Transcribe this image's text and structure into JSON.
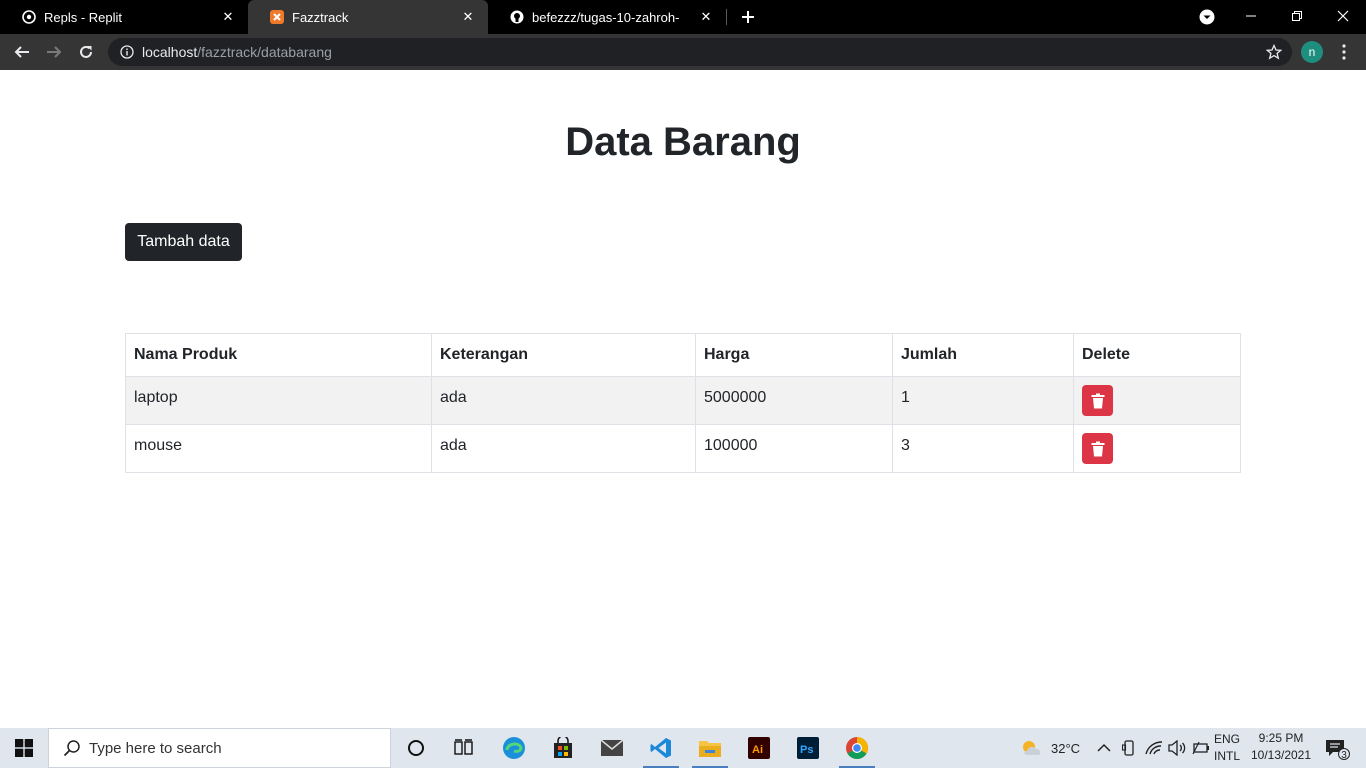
{
  "browser": {
    "tabs": [
      {
        "title": "Repls - Replit",
        "icon": "replit-icon",
        "active": false
      },
      {
        "title": "Fazztrack",
        "icon": "xampp-icon",
        "active": true
      },
      {
        "title": "befezzz/tugas-10-zahroh-",
        "icon": "github-icon",
        "active": false
      }
    ],
    "address": {
      "host": "localhost",
      "path": "/fazztrack/databarang"
    },
    "profile_initial": "n"
  },
  "page": {
    "title": "Data Barang",
    "add_button_label": "Tambah data",
    "table": {
      "headers": [
        "Nama Produk",
        "Keterangan",
        "Harga",
        "Jumlah",
        "Delete"
      ],
      "rows": [
        {
          "nama": "laptop",
          "keterangan": "ada",
          "harga": "5000000",
          "jumlah": "1"
        },
        {
          "nama": "mouse",
          "keterangan": "ada",
          "harga": "100000",
          "jumlah": "3"
        }
      ]
    }
  },
  "taskbar": {
    "search_placeholder": "Type here to search",
    "weather": "32°C",
    "lang_top": "ENG",
    "lang_bottom": "INTL",
    "time": "9:25 PM",
    "date": "10/13/2021",
    "notification_count": "3",
    "apps": [
      "cortana-icon",
      "task-view-icon",
      "edge-icon",
      "store-icon",
      "mail-icon",
      "vscode-icon",
      "file-explorer-icon",
      "illustrator-icon",
      "photoshop-icon",
      "chrome-icon"
    ]
  },
  "colors": {
    "delete_button": "#dc3545",
    "primary_dark": "#212529",
    "chrome_dark": "#353535"
  }
}
